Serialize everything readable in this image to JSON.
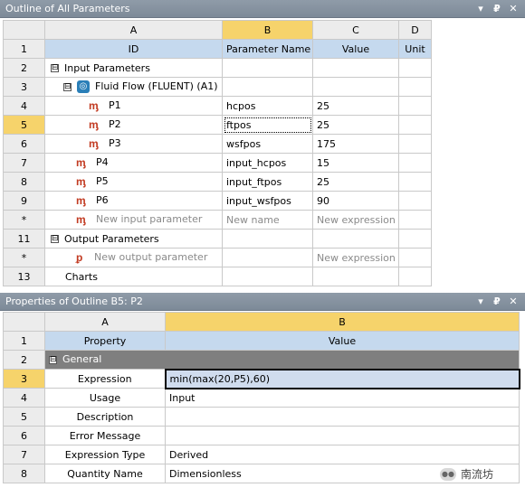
{
  "top_panel": {
    "title": "Outline of All Parameters",
    "buttons": {
      "menu": "▾",
      "pin": "₽",
      "close": "✕"
    },
    "columns": {
      "row": "",
      "a": "A",
      "b": "B",
      "c": "C",
      "d": "D"
    },
    "header_row": {
      "num": "1",
      "id": "ID",
      "param_name": "Parameter Name",
      "value": "Value",
      "unit": "Unit"
    },
    "rows": [
      {
        "num": "2",
        "id": "Input Parameters",
        "name": "",
        "value": "",
        "toggle": "⊟"
      },
      {
        "num": "3",
        "id": "Fluid Flow (FLUENT) (A1)",
        "name": "",
        "value": "",
        "toggle": "⊟"
      },
      {
        "num": "4",
        "id": "P1",
        "name": "hcpos",
        "value": "25"
      },
      {
        "num": "5",
        "id": "P2",
        "name": "ftpos",
        "value": "25"
      },
      {
        "num": "6",
        "id": "P3",
        "name": "wsfpos",
        "value": "175"
      },
      {
        "num": "7",
        "id": "P4",
        "name": "input_hcpos",
        "value": "15"
      },
      {
        "num": "8",
        "id": "P5",
        "name": "input_ftpos",
        "value": "25"
      },
      {
        "num": "9",
        "id": "P6",
        "name": "input_wsfpos",
        "value": "90"
      },
      {
        "num": "*",
        "id": "New input parameter",
        "name": "New name",
        "value": "New expression"
      },
      {
        "num": "11",
        "id": "Output Parameters",
        "name": "",
        "value": "",
        "toggle": "⊟"
      },
      {
        "num": "*",
        "id": "New output parameter",
        "name": "",
        "value": "New expression"
      },
      {
        "num": "13",
        "id": "Charts",
        "name": "",
        "value": ""
      }
    ]
  },
  "bottom_panel": {
    "title": "Properties of Outline B5: P2",
    "buttons": {
      "menu": "▾",
      "pin": "₽",
      "close": "✕"
    },
    "columns": {
      "a": "A",
      "b": "B"
    },
    "header_row": {
      "num": "1",
      "property": "Property",
      "value": "Value"
    },
    "group": {
      "num": "2",
      "label": "General",
      "toggle": "⊟"
    },
    "rows": [
      {
        "num": "3",
        "property": "Expression",
        "value": "min(max(20,P5),60)"
      },
      {
        "num": "4",
        "property": "Usage",
        "value": "Input"
      },
      {
        "num": "5",
        "property": "Description",
        "value": ""
      },
      {
        "num": "6",
        "property": "Error Message",
        "value": ""
      },
      {
        "num": "7",
        "property": "Expression Type",
        "value": "Derived"
      },
      {
        "num": "8",
        "property": "Quantity Name",
        "value": "Dimensionless"
      }
    ]
  },
  "watermark": {
    "text": "南流坊",
    "icon": "wechat-icon"
  },
  "colors": {
    "selected": "#f6d36b",
    "column_header": "#c5d9ee",
    "titlebar": "#8596a6",
    "param_icon": "#c23b22"
  }
}
